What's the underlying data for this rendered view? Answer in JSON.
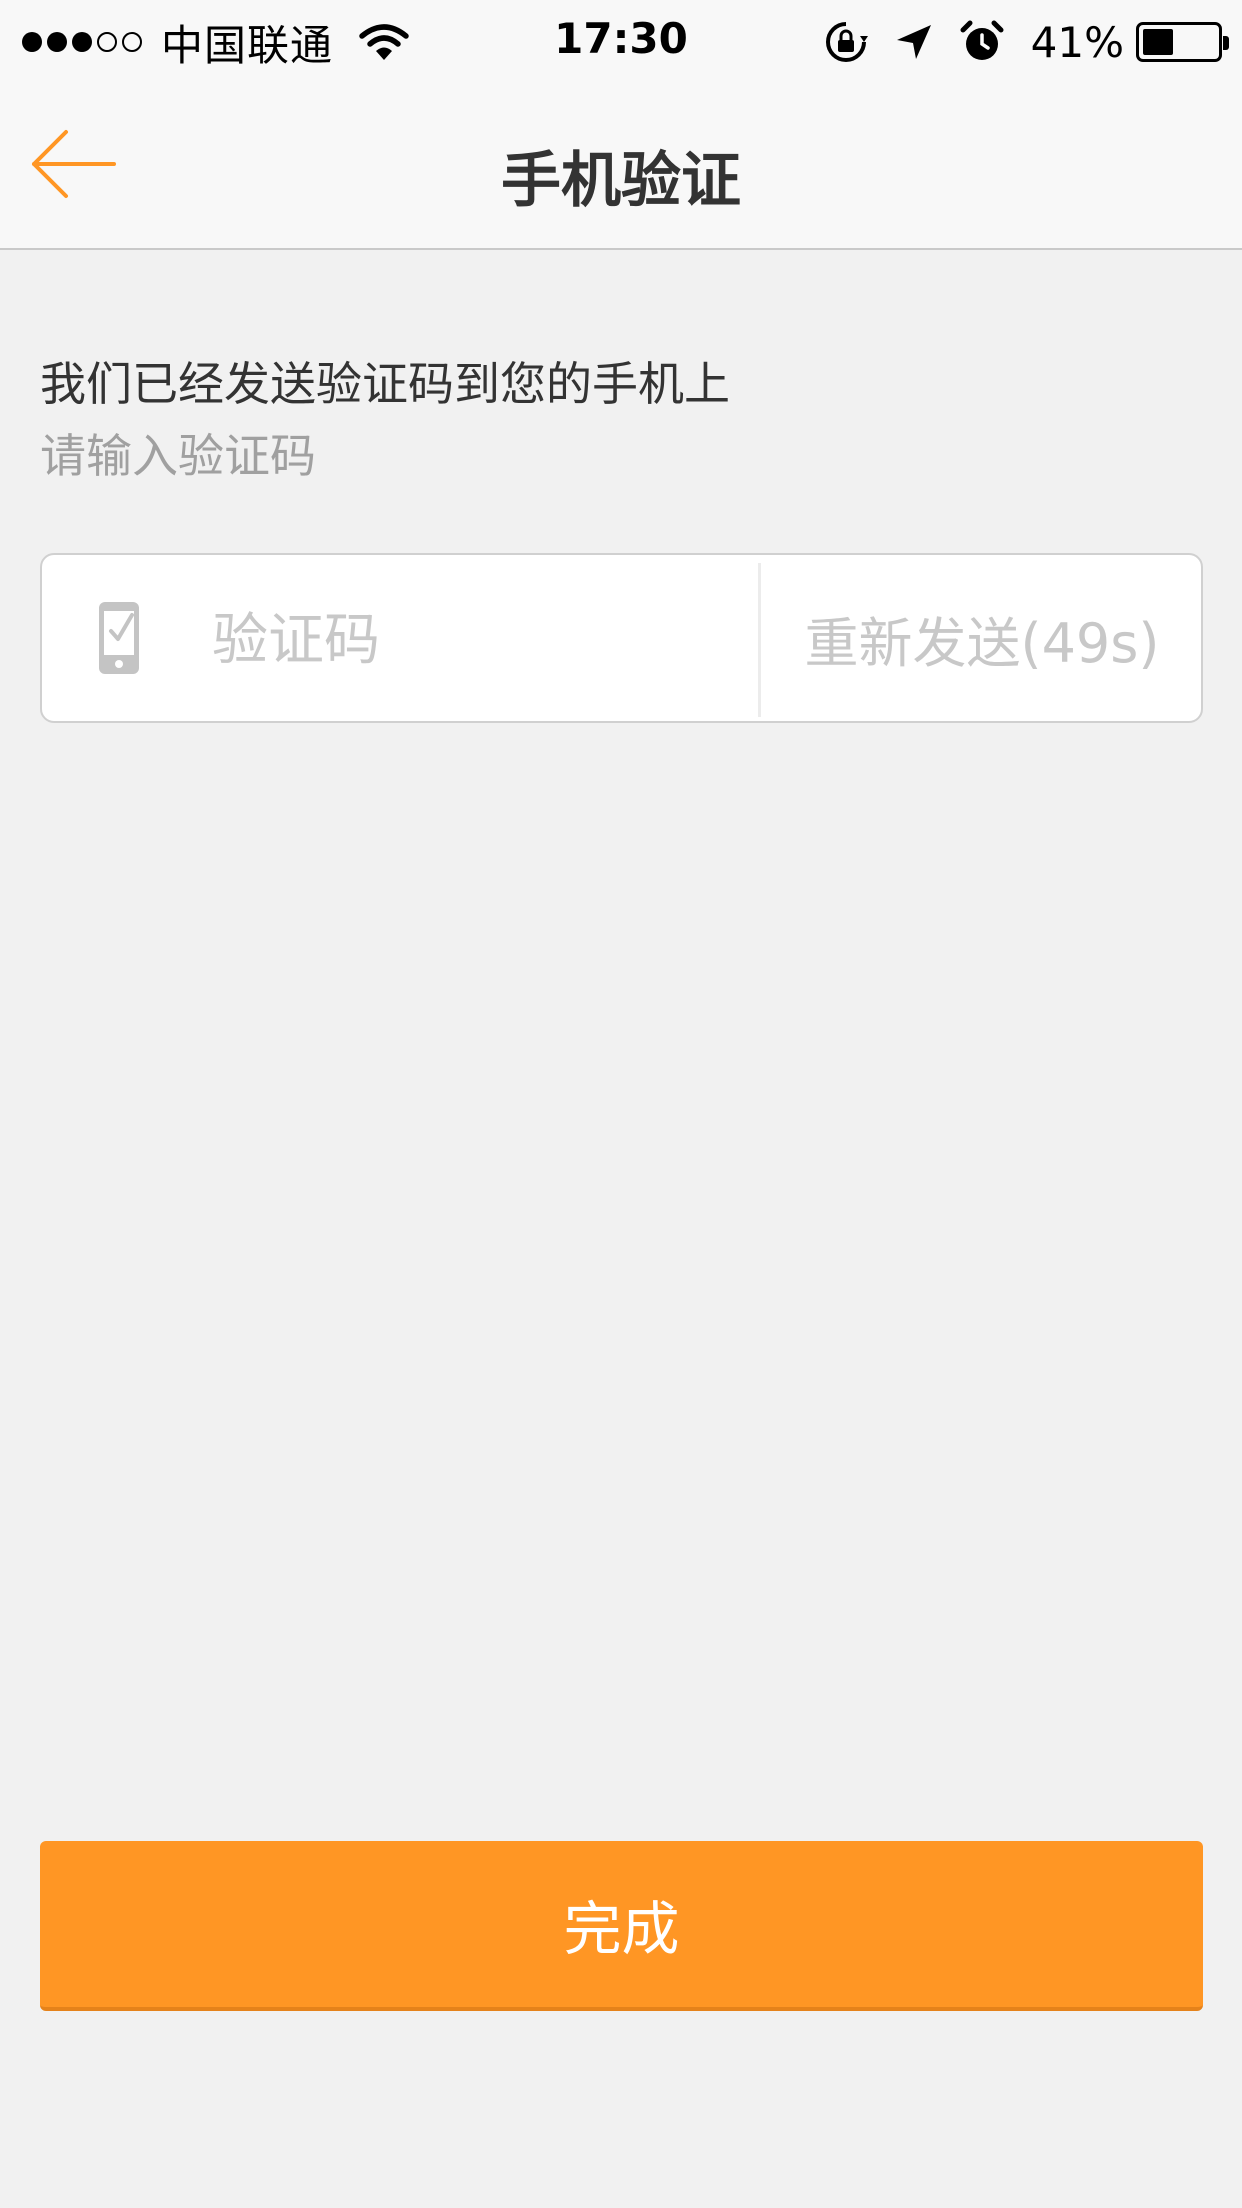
{
  "status_bar": {
    "signal_filled": 3,
    "signal_total": 5,
    "carrier": "中国联通",
    "time": "17:30",
    "battery_percent": "41%",
    "battery_level": 0.41,
    "icons": [
      "wifi-icon",
      "orientation-lock-icon",
      "location-arrow-icon",
      "alarm-icon",
      "battery-icon"
    ]
  },
  "nav": {
    "title": "手机验证",
    "back_icon": "back-arrow-icon",
    "accent_color": "#ff9624"
  },
  "instructions": {
    "main": "我们已经发送验证码到您的手机上",
    "sub": "请输入验证码"
  },
  "code_field": {
    "icon": "phone-check-icon",
    "placeholder": "验证码",
    "value": "",
    "resend_label": "重新发送(49s)"
  },
  "done_button": {
    "label": "完成",
    "color": "#ff9624"
  }
}
